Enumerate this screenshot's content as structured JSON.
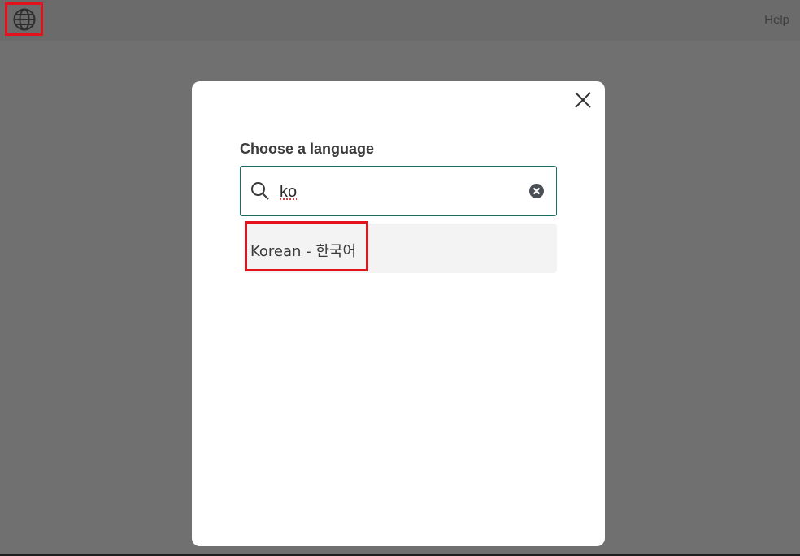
{
  "topbar": {
    "globe_icon": "globe-icon",
    "help_label": "Help"
  },
  "modal": {
    "close_icon": "close-icon",
    "title": "Choose a language",
    "search": {
      "icon": "search-icon",
      "value": "ko",
      "clear_icon": "clear-circle-icon"
    },
    "results": [
      {
        "label": "Korean - 한국어"
      }
    ]
  },
  "colors": {
    "backdrop": "#707070",
    "highlight_box": "#e3121d",
    "input_border": "#1b6b6b",
    "result_bg": "#f3f3f3"
  }
}
